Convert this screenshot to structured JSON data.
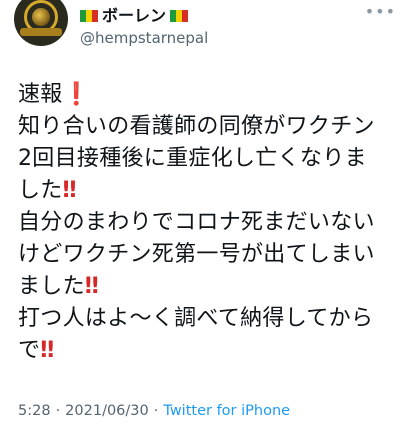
{
  "tweet": {
    "author": {
      "display_name": "ボーレン",
      "handle": "@hempstarnepal",
      "flag_colors": [
        "#1f9a3a",
        "#f2d200",
        "#d62f26"
      ]
    },
    "more_icon": "more-dots-icon",
    "text_lines": [
      {
        "text": "速報",
        "emoji": "❗"
      },
      {
        "text": "知り合いの看護師の同僚がワクチン",
        "emoji": ""
      },
      {
        "text": "2回目接種後に重症化し亡くなりま",
        "emoji": ""
      },
      {
        "text": "した",
        "emoji": "‼"
      },
      {
        "text": "自分のまわりでコロナ死まだいない",
        "emoji": ""
      },
      {
        "text": "けどワクチン死第一号が出てしまい",
        "emoji": ""
      },
      {
        "text": "ました",
        "emoji": "‼"
      },
      {
        "text": "打つ人はよ〜く調べて納得してから",
        "emoji": ""
      },
      {
        "text": "で",
        "emoji": "‼"
      }
    ],
    "timestamp_time": "5:28",
    "timestamp_date": "2021/06/30",
    "source": "Twitter for iPhone",
    "accent_color": "#1d9bf0"
  }
}
